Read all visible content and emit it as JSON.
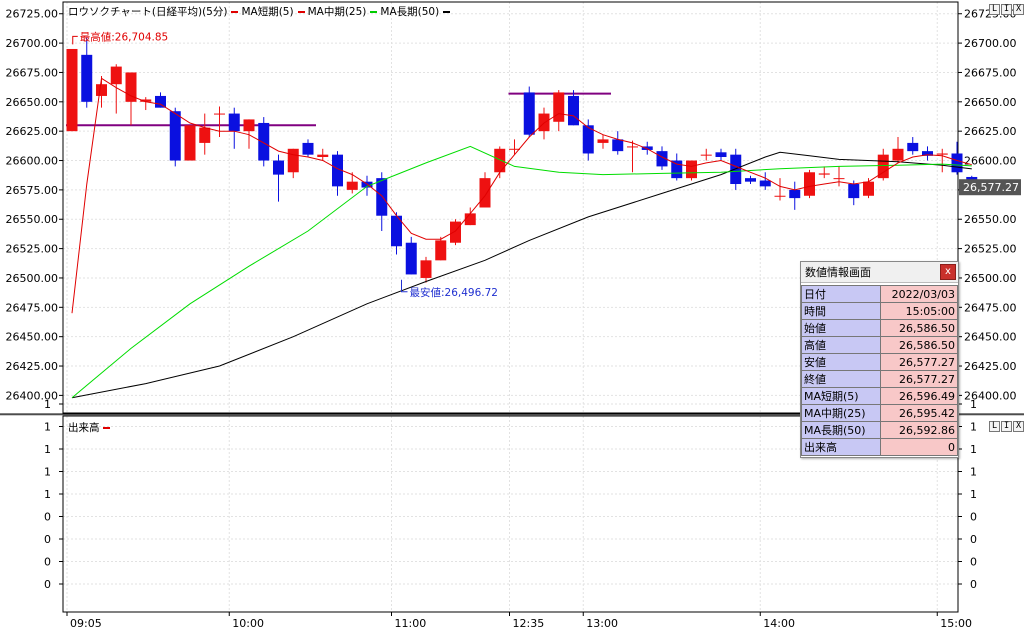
{
  "legend": {
    "title": "ロウソクチャート(日経平均)(5分)",
    "ma_short": "MA短期(5)",
    "ma_mid": "MA中期(25)",
    "ma_long": "MA長期(50)"
  },
  "volume_legend": "出来高",
  "window_buttons": [
    "L",
    "I",
    "X"
  ],
  "annotations": {
    "high": "最高値:26,704.85",
    "low": "最安値:26,496.72",
    "current_price": "26,577.27"
  },
  "colors": {
    "up": "#ee1111",
    "down": "#0a10e0",
    "ma_short": "#e00000",
    "ma_mid": "#00dd00",
    "ma_long": "#000000",
    "level_line": "#800080",
    "high_label": "#e00000",
    "low_label": "#2030d0"
  },
  "info_panel": {
    "title": "数値情報画面",
    "close": "x",
    "rows": [
      {
        "k": "日付",
        "v": "2022/03/03"
      },
      {
        "k": "時間",
        "v": "15:05:00"
      },
      {
        "k": "始値",
        "v": "26,586.50"
      },
      {
        "k": "高値",
        "v": "26,586.50"
      },
      {
        "k": "安値",
        "v": "26,577.27"
      },
      {
        "k": "終値",
        "v": "26,577.27"
      },
      {
        "k": "MA短期(5)",
        "v": "26,596.49"
      },
      {
        "k": "MA中期(25)",
        "v": "26,595.42"
      },
      {
        "k": "MA長期(50)",
        "v": "26,592.86"
      },
      {
        "k": "出来高",
        "v": "0"
      }
    ]
  },
  "chart_data": {
    "type": "candlestick",
    "price_axis": {
      "min": 26385,
      "max": 26735,
      "ticks": [
        "26400.00",
        "26425.00",
        "26450.00",
        "26475.00",
        "26500.00",
        "26525.00",
        "26550.00",
        "26575.00",
        "26600.00",
        "26625.00",
        "26650.00",
        "26675.00",
        "26700.00",
        "26725.00"
      ]
    },
    "volume_axis": {
      "ticks": [
        "0",
        "0",
        "0",
        "0",
        "1",
        "1",
        "1",
        "1",
        "1"
      ]
    },
    "time_labels": [
      {
        "i": 0,
        "label": "09:05"
      },
      {
        "i": 11,
        "label": "10:00"
      },
      {
        "i": 22,
        "label": "11:00"
      },
      {
        "i": 30,
        "label": "12:35"
      },
      {
        "i": 35,
        "label": "13:00"
      },
      {
        "i": 47,
        "label": "14:00"
      },
      {
        "i": 59,
        "label": "15:00"
      }
    ],
    "candles": [
      [
        26625,
        26695,
        26625,
        26695
      ],
      [
        26690,
        26705,
        26645,
        26650
      ],
      [
        26655,
        26672,
        26645,
        26665
      ],
      [
        26665,
        26682,
        26640,
        26680
      ],
      [
        26650,
        26675,
        26630,
        26675
      ],
      [
        26650,
        26654,
        26643,
        26652
      ],
      [
        26655,
        26658,
        26645,
        26645
      ],
      [
        26642,
        26645,
        26595,
        26600
      ],
      [
        26600,
        26630,
        26600,
        26630
      ],
      [
        26615,
        26640,
        26605,
        26628
      ],
      [
        26640,
        26646,
        26620,
        26640
      ],
      [
        26640,
        26645,
        26610,
        26625
      ],
      [
        26625,
        26635,
        26610,
        26635
      ],
      [
        26632,
        26637,
        26595,
        26600
      ],
      [
        26600,
        26605,
        26565,
        26588
      ],
      [
        26590,
        26610,
        26585,
        26610
      ],
      [
        26615,
        26618,
        26603,
        26605
      ],
      [
        26603,
        26610,
        26600,
        26605
      ],
      [
        26605,
        26608,
        26570,
        26578
      ],
      [
        26575,
        26590,
        26572,
        26582
      ],
      [
        26582,
        26587,
        26570,
        26577
      ],
      [
        26585,
        26590,
        26540,
        26553
      ],
      [
        26553,
        26556,
        26520,
        26527
      ],
      [
        26530,
        26535,
        26503,
        26503
      ],
      [
        26500,
        26518,
        26496,
        26515
      ],
      [
        26515,
        26535,
        26515,
        26532
      ],
      [
        26530,
        26550,
        26528,
        26548
      ],
      [
        26545,
        26560,
        26545,
        26555
      ],
      [
        26560,
        26590,
        26560,
        26585
      ],
      [
        26590,
        26612,
        26585,
        26610
      ],
      [
        26610,
        26618,
        26605,
        26610
      ],
      [
        26658,
        26663,
        26620,
        26622
      ],
      [
        26625,
        26645,
        26618,
        26640
      ],
      [
        26633,
        26660,
        26625,
        26658
      ],
      [
        26655,
        26660,
        26630,
        26630
      ],
      [
        26630,
        26635,
        26600,
        26606
      ],
      [
        26615,
        26622,
        26610,
        26618
      ],
      [
        26618,
        26625,
        26605,
        26608
      ],
      [
        26612,
        26617,
        26590,
        26612
      ],
      [
        26612,
        26616,
        26605,
        26609
      ],
      [
        26608,
        26612,
        26592,
        26595
      ],
      [
        26600,
        26606,
        26583,
        26585
      ],
      [
        26585,
        26600,
        26583,
        26600
      ],
      [
        26605,
        26610,
        26600,
        26605
      ],
      [
        26607,
        26610,
        26600,
        26603
      ],
      [
        26605,
        26610,
        26575,
        26580
      ],
      [
        26585,
        26587,
        26580,
        26582
      ],
      [
        26583,
        26590,
        26575,
        26578
      ],
      [
        26570,
        26585,
        26566,
        26570
      ],
      [
        26575,
        26582,
        26558,
        26568
      ],
      [
        26570,
        26592,
        26568,
        26590
      ],
      [
        26588,
        26595,
        26585,
        26589
      ],
      [
        26585,
        26595,
        26578,
        26585
      ],
      [
        26580,
        26583,
        26562,
        26568
      ],
      [
        26570,
        26585,
        26568,
        26582
      ],
      [
        26585,
        26610,
        26583,
        26605
      ],
      [
        26600,
        26620,
        26598,
        26610
      ],
      [
        26615,
        26620,
        26605,
        26608
      ],
      [
        26608,
        26612,
        26600,
        26604
      ],
      [
        26605,
        26610,
        26590,
        26606
      ],
      [
        26606,
        26616,
        26588,
        26590
      ],
      [
        26586,
        26587,
        26577,
        26577
      ]
    ],
    "ma_short": [
      [
        0,
        26470
      ],
      [
        1,
        26580
      ],
      [
        2,
        26670
      ],
      [
        3,
        26662
      ],
      [
        4,
        26655
      ],
      [
        5,
        26650
      ],
      [
        6,
        26648
      ],
      [
        7,
        26640
      ],
      [
        8,
        26632
      ],
      [
        9,
        26628
      ],
      [
        10,
        26625
      ],
      [
        11,
        26625
      ],
      [
        12,
        26622
      ],
      [
        13,
        26615
      ],
      [
        14,
        26608
      ],
      [
        15,
        26605
      ],
      [
        16,
        26603
      ],
      [
        17,
        26600
      ],
      [
        18,
        26593
      ],
      [
        19,
        26588
      ],
      [
        20,
        26580
      ],
      [
        21,
        26570
      ],
      [
        22,
        26553
      ],
      [
        23,
        26538
      ],
      [
        24,
        26533
      ],
      [
        25,
        26533
      ],
      [
        26,
        26540
      ],
      [
        27,
        26555
      ],
      [
        28,
        26570
      ],
      [
        29,
        26590
      ],
      [
        30,
        26605
      ],
      [
        31,
        26620
      ],
      [
        32,
        26632
      ],
      [
        33,
        26640
      ],
      [
        34,
        26638
      ],
      [
        35,
        26628
      ],
      [
        36,
        26622
      ],
      [
        37,
        26618
      ],
      [
        38,
        26615
      ],
      [
        39,
        26610
      ],
      [
        40,
        26603
      ],
      [
        41,
        26597
      ],
      [
        42,
        26595
      ],
      [
        43,
        26598
      ],
      [
        44,
        26600
      ],
      [
        45,
        26595
      ],
      [
        46,
        26590
      ],
      [
        47,
        26585
      ],
      [
        48,
        26578
      ],
      [
        49,
        26575
      ],
      [
        50,
        26578
      ],
      [
        51,
        26580
      ],
      [
        52,
        26582
      ],
      [
        53,
        26580
      ],
      [
        54,
        26582
      ],
      [
        55,
        26590
      ],
      [
        56,
        26598
      ],
      [
        57,
        26603
      ],
      [
        58,
        26605
      ],
      [
        59,
        26604
      ],
      [
        60,
        26600
      ],
      [
        61,
        26596.49
      ]
    ],
    "ma_mid": [
      [
        0,
        26398
      ],
      [
        4,
        26440
      ],
      [
        8,
        26478
      ],
      [
        12,
        26510
      ],
      [
        16,
        26540
      ],
      [
        20,
        26578
      ],
      [
        24,
        26598
      ],
      [
        27,
        26612
      ],
      [
        30,
        26595
      ],
      [
        33,
        26590
      ],
      [
        36,
        26588
      ],
      [
        40,
        26589
      ],
      [
        44,
        26590
      ],
      [
        48,
        26593
      ],
      [
        52,
        26595
      ],
      [
        56,
        26596
      ],
      [
        59,
        26597
      ],
      [
        61,
        26595.42
      ]
    ],
    "ma_long": [
      [
        0,
        26398
      ],
      [
        5,
        26410
      ],
      [
        10,
        26425
      ],
      [
        15,
        26450
      ],
      [
        20,
        26478
      ],
      [
        24,
        26497
      ],
      [
        28,
        26515
      ],
      [
        31,
        26532
      ],
      [
        35,
        26552
      ],
      [
        40,
        26572
      ],
      [
        44,
        26588
      ],
      [
        47,
        26603
      ],
      [
        48,
        26607
      ],
      [
        50,
        26604
      ],
      [
        52,
        26601
      ],
      [
        56,
        26599
      ],
      [
        59,
        26596
      ],
      [
        61,
        26592.86
      ]
    ],
    "levels": [
      {
        "from": 0,
        "to": 16,
        "price": 26630
      },
      {
        "from": 30,
        "to": 36,
        "price": 26657
      }
    ],
    "high_point": {
      "i": 1,
      "price": 26704.85
    },
    "low_point": {
      "i": 22,
      "price": 26496.72
    },
    "last_price": 26577.27
  }
}
